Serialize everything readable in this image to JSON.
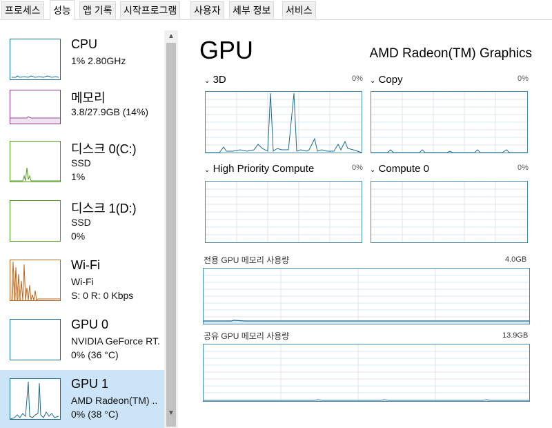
{
  "tabs": [
    "프로세스",
    "성능",
    "앱 기록",
    "시작프로그램",
    "사용자",
    "세부 정보",
    "서비스"
  ],
  "active_tab": "성능",
  "devices": [
    {
      "name": "CPU",
      "line1": "1% 2.80GHz",
      "line2": ""
    },
    {
      "name": "메모리",
      "line1": "3.8/27.9GB (14%)",
      "line2": ""
    },
    {
      "name": "디스크 0(C:)",
      "line1": "SSD",
      "line2": "1%"
    },
    {
      "name": "디스크 1(D:)",
      "line1": "SSD",
      "line2": "0%"
    },
    {
      "name": "Wi-Fi",
      "line1": "Wi-Fi",
      "line2": "S: 0 R: 0 Kbps"
    },
    {
      "name": "GPU 0",
      "line1": "NVIDIA GeForce RT.",
      "line2": "0% (36 °C)"
    },
    {
      "name": "GPU 1",
      "line1": "AMD Radeon(TM) ..",
      "line2": "0% (38 °C)"
    }
  ],
  "header": {
    "title": "GPU",
    "subtitle": "AMD Radeon(TM) Graphics"
  },
  "engines": [
    {
      "label": "3D",
      "pct": "0%"
    },
    {
      "label": "Copy",
      "pct": "0%"
    },
    {
      "label": "High Priority Compute",
      "pct": "0%"
    },
    {
      "label": "Compute 0",
      "pct": "0%"
    }
  ],
  "dedicated": {
    "label": "전용 GPU 메모리 사용량",
    "value": "4.0GB"
  },
  "shared": {
    "label": "공유 GPU 메모리 사용량",
    "value": "13.9GB"
  },
  "colors": {
    "graph": "#1b6a8f",
    "selected": "#cce4f7",
    "disk": "#4d9a1c",
    "wifi": "#b5651d",
    "memory": "#8b3a8b"
  }
}
